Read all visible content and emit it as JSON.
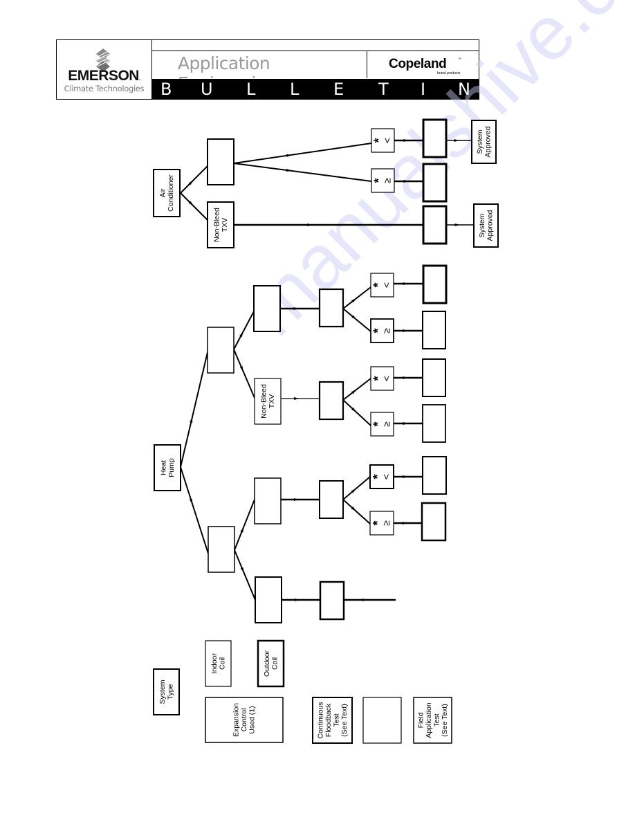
{
  "header": {
    "company": "EMERSON",
    "company_mark": ".",
    "division": "Climate Technologies",
    "title": "Application Engineering",
    "brand": "Copeland",
    "brand_tm": "™",
    "brand_sub": "brand products",
    "banner_letters": [
      "B",
      "U",
      "L",
      "L",
      "E",
      "T",
      "I",
      "N"
    ]
  },
  "colors": {
    "ink": "#000000",
    "header_gray": "#9a9a9a",
    "watermark": "#c9c9f5"
  },
  "watermark": "manualshive.com",
  "diagram": {
    "orientation": "rotated-90-ccw",
    "symbols": {
      "lt": "<",
      "ge": "≥",
      "asterisk": "*"
    },
    "boxes": [
      {
        "id": "ac-system",
        "label": [
          "Air",
          "Conditioner"
        ],
        "kind": "system-type"
      },
      {
        "id": "ac-indoor",
        "label": [],
        "kind": "indoor-coil"
      },
      {
        "id": "ac-txv",
        "label": [
          "Non-Bleed",
          "TXV"
        ],
        "kind": "expansion"
      },
      {
        "id": "ac-lt",
        "label": [
          "*",
          "<"
        ],
        "kind": "condition"
      },
      {
        "id": "ac-ge",
        "label": [
          "*",
          "≥"
        ],
        "kind": "condition"
      },
      {
        "id": "ac-lt-test",
        "label": [],
        "kind": "test-blank"
      },
      {
        "id": "ac-ge-test",
        "label": [],
        "kind": "test-blank"
      },
      {
        "id": "ac-txv-test",
        "label": [],
        "kind": "test-blank"
      },
      {
        "id": "ac-lt-approved",
        "label": [
          "System",
          "Approved"
        ],
        "kind": "result"
      },
      {
        "id": "ac-txv-approved",
        "label": [
          "System",
          "Approved"
        ],
        "kind": "result"
      },
      {
        "id": "hp-system",
        "label": [
          "Heat",
          "Pump"
        ],
        "kind": "system-type"
      },
      {
        "id": "hp-indoor-1",
        "label": [],
        "kind": "indoor-coil"
      },
      {
        "id": "hp-outdoor-1",
        "label": [],
        "kind": "outdoor-coil"
      },
      {
        "id": "hp-txv-1",
        "label": [
          "Non-Bleed",
          "TXV"
        ],
        "kind": "expansion"
      },
      {
        "id": "hp-mid-1a",
        "label": [],
        "kind": "test-blank"
      },
      {
        "id": "hp-mid-1b",
        "label": [],
        "kind": "test-blank"
      },
      {
        "id": "hp-c1a-lt",
        "label": [
          "*",
          "<"
        ],
        "kind": "condition"
      },
      {
        "id": "hp-c1a-ge",
        "label": [
          "*",
          "≥"
        ],
        "kind": "condition"
      },
      {
        "id": "hp-c1b-lt",
        "label": [
          "*",
          "<"
        ],
        "kind": "condition"
      },
      {
        "id": "hp-c1b-ge",
        "label": [
          "*",
          "≥"
        ],
        "kind": "condition"
      },
      {
        "id": "hp-e1a-lt",
        "label": [],
        "kind": "test-blank"
      },
      {
        "id": "hp-e1a-ge",
        "label": [],
        "kind": "test-blank"
      },
      {
        "id": "hp-e1b-lt",
        "label": [],
        "kind": "test-blank"
      },
      {
        "id": "hp-e1b-ge",
        "label": [],
        "kind": "test-blank"
      },
      {
        "id": "hp-indoor-2",
        "label": [],
        "kind": "indoor-coil"
      },
      {
        "id": "hp-outdoor-2a",
        "label": [],
        "kind": "outdoor-coil"
      },
      {
        "id": "hp-outdoor-2b",
        "label": [],
        "kind": "outdoor-coil"
      },
      {
        "id": "hp-mid-2a",
        "label": [],
        "kind": "test-blank"
      },
      {
        "id": "hp-mid-2b",
        "label": [],
        "kind": "test-blank"
      },
      {
        "id": "hp-c2-lt",
        "label": [
          "*",
          "<"
        ],
        "kind": "condition"
      },
      {
        "id": "hp-c2-ge",
        "label": [
          "*",
          "≥"
        ],
        "kind": "condition"
      },
      {
        "id": "hp-e2-lt",
        "label": [],
        "kind": "test-blank"
      },
      {
        "id": "hp-e2-ge",
        "label": [],
        "kind": "test-blank"
      }
    ],
    "legend": [
      {
        "id": "legend-system-type",
        "label": [
          "System",
          "Type"
        ]
      },
      {
        "id": "legend-indoor-coil",
        "label": [
          "Indoor",
          "Coil"
        ]
      },
      {
        "id": "legend-outdoor-coil",
        "label": [
          "Outdoor",
          "Coil"
        ]
      },
      {
        "id": "legend-expansion",
        "label": [
          "Expansion",
          "Control",
          "Used (1)"
        ]
      },
      {
        "id": "legend-floodback",
        "label": [
          "Continuous",
          "Floodback",
          "Test",
          "(See Text)"
        ]
      },
      {
        "id": "legend-blank",
        "label": []
      },
      {
        "id": "legend-field-test",
        "label": [
          "Field",
          "Application",
          "Test",
          "(See Text)"
        ]
      }
    ]
  }
}
